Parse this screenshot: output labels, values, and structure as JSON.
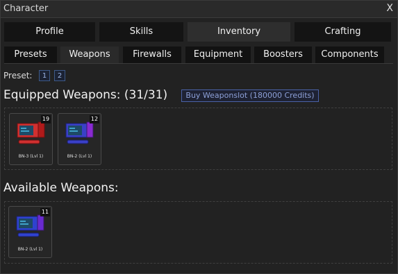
{
  "window": {
    "title": "Character",
    "close_label": "X"
  },
  "main_tabs": [
    {
      "label": "Profile",
      "active": false
    },
    {
      "label": "Skills",
      "active": false
    },
    {
      "label": "Inventory",
      "active": true
    },
    {
      "label": "Crafting",
      "active": false
    }
  ],
  "sub_tabs": [
    {
      "label": "Presets",
      "active": false
    },
    {
      "label": "Weapons",
      "active": true
    },
    {
      "label": "Firewalls",
      "active": false
    },
    {
      "label": "Equipment",
      "active": false
    },
    {
      "label": "Boosters",
      "active": false
    },
    {
      "label": "Components",
      "active": false
    }
  ],
  "preset": {
    "label": "Preset:",
    "options": [
      "1",
      "2"
    ]
  },
  "equipped": {
    "heading": "Equipped Weapons: (31/31)",
    "buy_label": "Buy Weaponslot (180000 Credits)",
    "items": [
      {
        "name": "BN-3 (Lvl 1)",
        "count": "19",
        "color": "#d03030",
        "accent": "#8a1a1a"
      },
      {
        "name": "BN-2 (Lvl 1)",
        "count": "12",
        "color": "#3a40c8",
        "accent": "#8a2ad0"
      }
    ]
  },
  "available": {
    "heading": "Available Weapons:",
    "items": [
      {
        "name": "BN-2 (Lvl 1)",
        "count": "11",
        "color": "#2f42d0",
        "accent": "#6a2ad0"
      }
    ]
  },
  "icons": {
    "weapon": "weapon-computer-icon"
  },
  "colors": {
    "window_bg": "#222222",
    "tab_active": "#2e2e2e",
    "accent_blue": "#4a62a8"
  }
}
